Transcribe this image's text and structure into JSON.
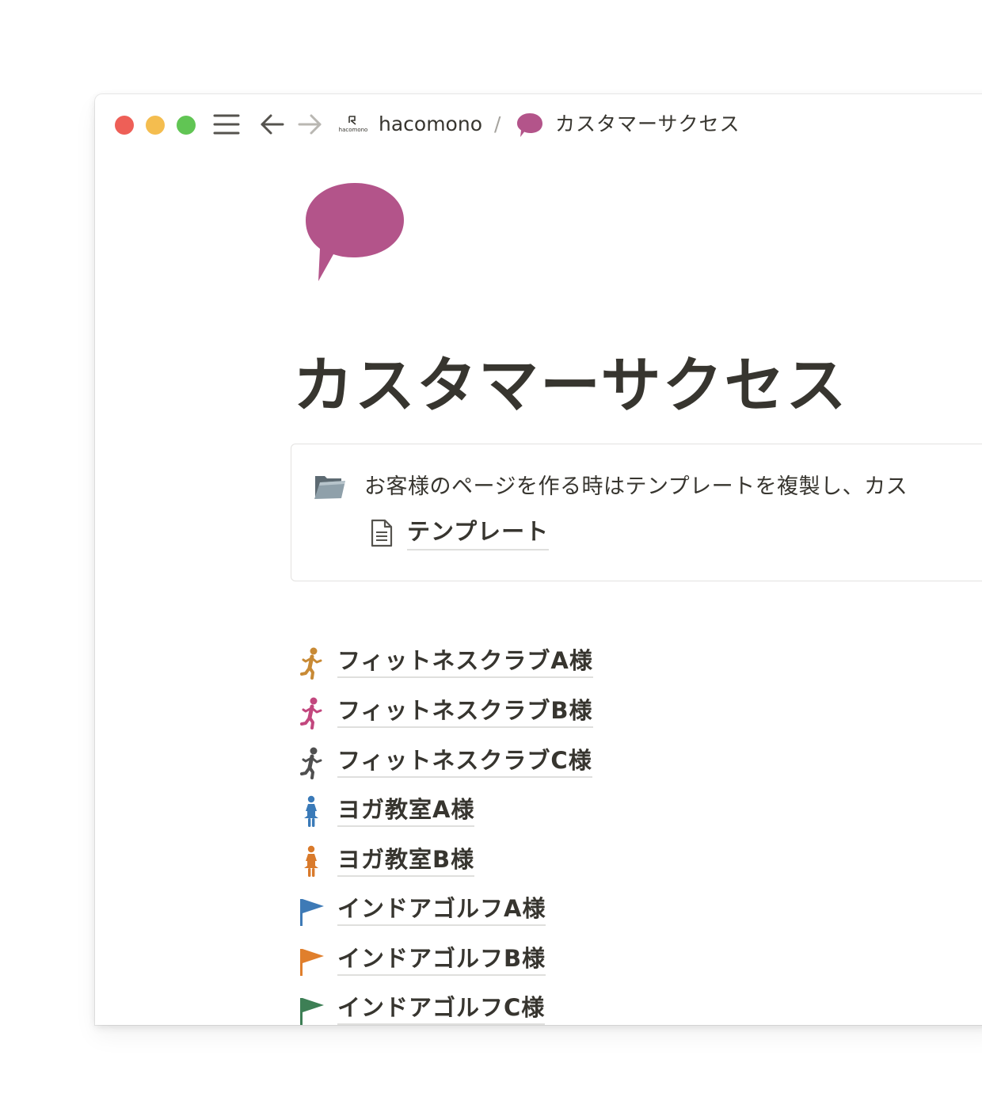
{
  "titlebar": {
    "workspace_logo_text": "hacomono",
    "workspace_name": "hacomono",
    "separator": "/",
    "current_page": "カスタマーサクセス"
  },
  "page": {
    "title": "カスタマーサクセス",
    "icon": "speech-bubble-icon",
    "icon_color": "#b3548a"
  },
  "callout": {
    "icon": "folder-icon",
    "text": "お客様のページを作る時はテンプレートを複製し、カス",
    "template_link": {
      "icon": "document-icon",
      "label": "テンプレート"
    }
  },
  "customer_pages": [
    {
      "label": "フィットネスクラブA様",
      "icon": "running-person-icon",
      "color": "#c88a35"
    },
    {
      "label": "フィットネスクラブB様",
      "icon": "running-person-icon",
      "color": "#c2477e"
    },
    {
      "label": "フィットネスクラブC様",
      "icon": "running-person-icon",
      "color": "#4f4f4f"
    },
    {
      "label": "ヨガ教室A様",
      "icon": "woman-icon",
      "color": "#3a7ab8"
    },
    {
      "label": "ヨガ教室B様",
      "icon": "woman-icon",
      "color": "#d97a2b"
    },
    {
      "label": "インドアゴルフA様",
      "icon": "flag-icon",
      "color": "#3e7ab6"
    },
    {
      "label": "インドアゴルフB様",
      "icon": "flag-icon",
      "color": "#e07f2c"
    },
    {
      "label": "インドアゴルフC様",
      "icon": "flag-icon",
      "color": "#3d7f55"
    }
  ],
  "colors": {
    "traffic_close": "#ee5f57",
    "traffic_minimize": "#f4bd4f",
    "traffic_maximize": "#61c554",
    "text": "#37352f",
    "link_underline": "#dfdfdd"
  }
}
